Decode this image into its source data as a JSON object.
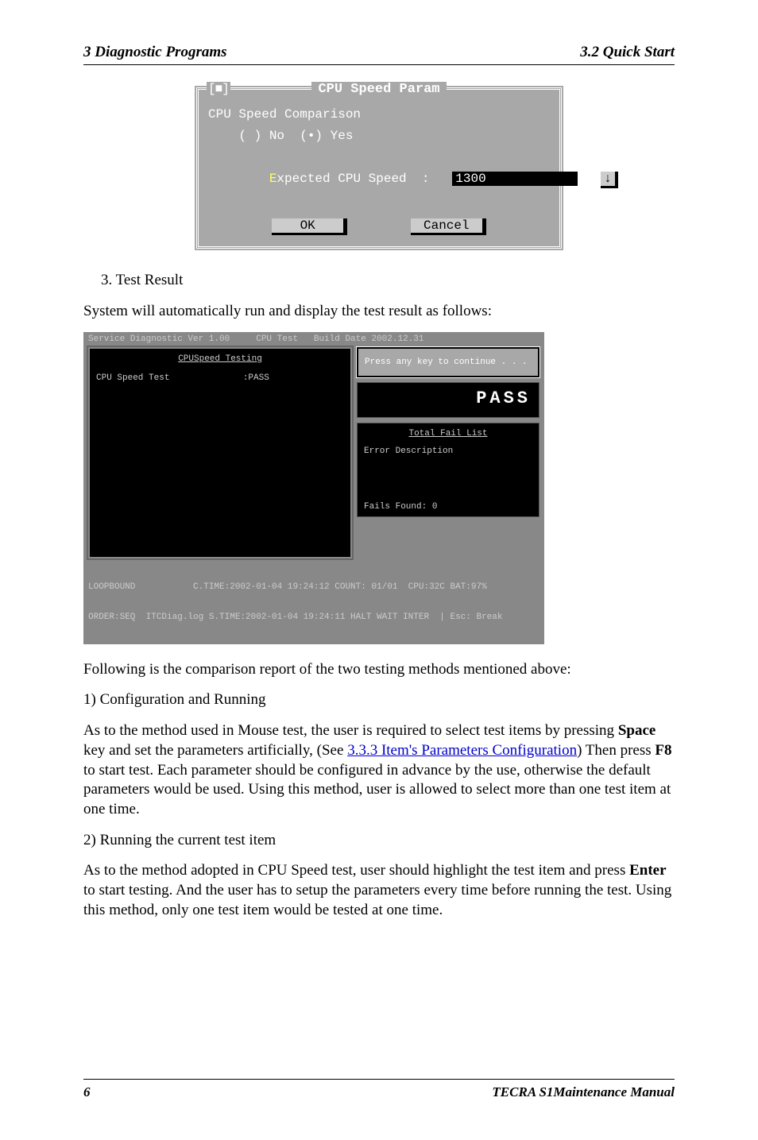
{
  "header": {
    "left": "3  Diagnostic Programs",
    "right": "3.2 Quick Start"
  },
  "footer": {
    "page": "6",
    "manual": "TECRA S1Maintenance Manual"
  },
  "dialog1": {
    "close_glyph": "[■]",
    "title": "CPU Speed Param",
    "line1": "CPU Speed Comparison",
    "radio_line_pre": "    ( ) ",
    "radio_no": "No",
    "radio_mid": "  (•) ",
    "radio_yes": "Yes",
    "expected_hot": "E",
    "expected_rest": "xpected CPU Speed  :",
    "expected_value": "1300",
    "down": "↓",
    "ok": "OK",
    "cancel": "Cancel"
  },
  "body": {
    "li3": "3.  Test Result",
    "p1": "System will automatically run and display the test result as follows:",
    "p2": "Following is the comparison report of the two testing methods mentioned above:",
    "h1": "1) Configuration and Running",
    "p3a": "As to the method used in Mouse test, the user is required to select test items by pressing ",
    "p3_space": "Space",
    "p3b": " key and set the parameters artificially, (See ",
    "p3_link": "3.3.3 Item's Parameters Configuration",
    "p3c": ") Then press ",
    "p3_f8": "F8",
    "p3d": " to start test. Each parameter should be configured in advance by the use, otherwise the default parameters would be used. Using this method, user is allowed to select more than one test item at one time.",
    "h2": "2) Running the current test item",
    "p4a": "As to the method adopted in CPU Speed test, user should highlight the test item and press ",
    "p4_enter": "Enter",
    "p4b": " to start testing. And the user has to setup the parameters every time before running the test. Using this method, only one test item would be tested at one time."
  },
  "screen2": {
    "top": "Service Diagnostic Ver 1.00     CPU Test   Build Date 2002.12.31",
    "left_title": "CPUSpeed Testing",
    "left_row": "CPU Speed Test              :PASS",
    "popup": "Press any key to continue . . .",
    "big": "PASS",
    "fail_title": "Total Fail List",
    "fail_cols": "Error  Description",
    "fail_found": "Fails Found: 0",
    "foot1": "LOOPBOUND           C.TIME:2002-01-04 19:24:12 COUNT: 01/01  CPU:32C BAT:97%",
    "foot2": "ORDER:SEQ  ITCDiag.log S.TIME:2002-01-04 19:24:11 HALT WAIT INTER  | Esc: Break"
  }
}
